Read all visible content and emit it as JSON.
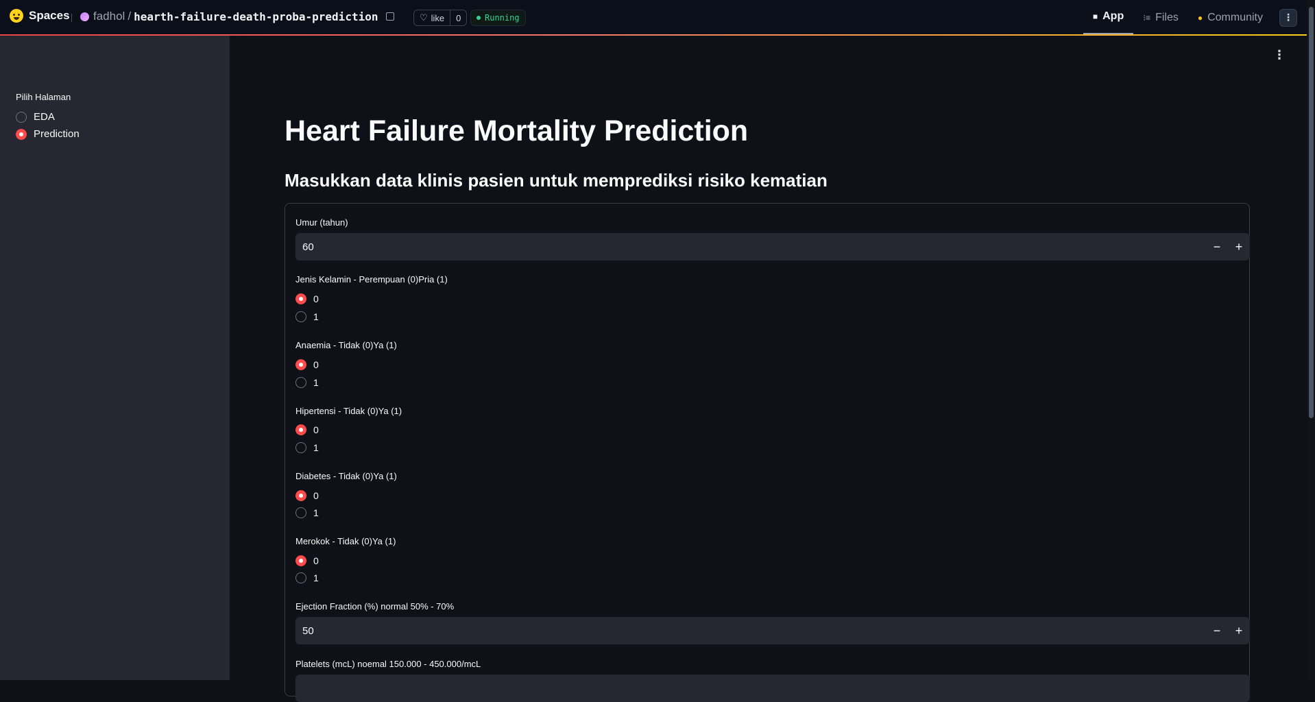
{
  "header": {
    "brand": "Spaces",
    "owner": "fadhol",
    "slash": "/",
    "repo": "hearth-failure-death-proba-prediction",
    "like_label": "like",
    "like_count": "0",
    "status": "Running",
    "tabs": [
      {
        "label": "App",
        "icon": "cube-icon"
      },
      {
        "label": "Files",
        "icon": "files-icon"
      },
      {
        "label": "Community",
        "icon": "community-icon"
      }
    ]
  },
  "sidebar": {
    "label": "Pilih Halaman",
    "options": [
      {
        "label": "EDA",
        "selected": false
      },
      {
        "label": "Prediction",
        "selected": true
      }
    ]
  },
  "main": {
    "title": "Heart Failure Mortality Prediction",
    "subtitle": "Masukkan data klinis pasien untuk memprediksi risiko kematian",
    "fields": {
      "umur": {
        "label": "Umur (tahun)",
        "value": "60"
      },
      "jenis_kelamin": {
        "label": "Jenis Kelamin - Perempuan (0)Pria (1)",
        "options": [
          "0",
          "1"
        ],
        "selected": "0"
      },
      "anaemia": {
        "label": "Anaemia - Tidak (0)Ya (1)",
        "options": [
          "0",
          "1"
        ],
        "selected": "0"
      },
      "hipertensi": {
        "label": "Hipertensi - Tidak (0)Ya (1)",
        "options": [
          "0",
          "1"
        ],
        "selected": "0"
      },
      "diabetes": {
        "label": "Diabetes - Tidak (0)Ya (1)",
        "options": [
          "0",
          "1"
        ],
        "selected": "0"
      },
      "merokok": {
        "label": "Merokok - Tidak (0)Ya (1)",
        "options": [
          "0",
          "1"
        ],
        "selected": "0"
      },
      "ejection_fraction": {
        "label": "Ejection Fraction (%) normal 50% - 70%",
        "value": "50"
      },
      "platelets": {
        "label": "Platelets (mcL) noemal 150.000 - 450.000/mcL"
      }
    },
    "stepper": {
      "minus": "−",
      "plus": "+"
    }
  },
  "colors": {
    "accent": "#ff4b4b",
    "running": "#34d399",
    "background": "#0e1117",
    "sidebar": "#262730"
  }
}
